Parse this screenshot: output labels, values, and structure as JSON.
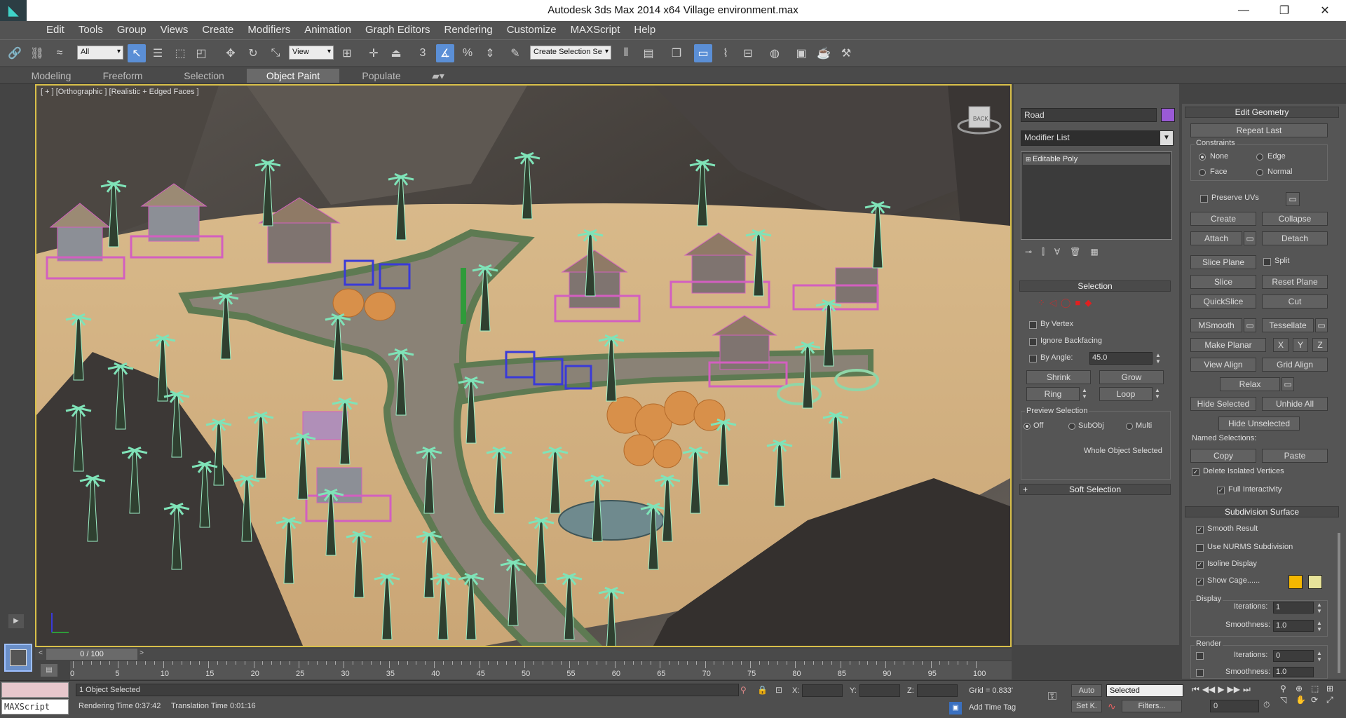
{
  "window": {
    "title": "Autodesk 3ds Max  2014 x64      Village environment.max",
    "min_glyph": "—",
    "max_glyph": "❐",
    "close_glyph": "✕"
  },
  "menu": [
    "Edit",
    "Tools",
    "Group",
    "Views",
    "Create",
    "Modifiers",
    "Animation",
    "Graph Editors",
    "Rendering",
    "Customize",
    "MAXScript",
    "Help"
  ],
  "toolbar": {
    "filter_value": "All",
    "refcoord_value": "View",
    "named_selection_placeholder": "Create Selection Se",
    "snap_3_label": "3",
    "snap_angle_label": "%"
  },
  "ribbon_tabs": [
    "Modeling",
    "Freeform",
    "Selection",
    "Object Paint",
    "Populate"
  ],
  "viewport": {
    "label": "[ + ] [Orthographic ] [Realistic + Edged Faces ]",
    "viewcube_label": "BACK"
  },
  "command_panel": {
    "object_name": "Road",
    "object_color": "#9a5ad6",
    "modifier_list": "Modifier List",
    "stack_item": "Editable Poly",
    "selection": {
      "header": "Selection",
      "by_vertex": "By Vertex",
      "ignore_backfacing": "Ignore Backfacing",
      "by_angle": "By Angle:",
      "angle_value": "45.0",
      "shrink": "Shrink",
      "grow": "Grow",
      "ring": "Ring",
      "loop": "Loop",
      "preview_selection": "Preview Selection",
      "off": "Off",
      "subobj": "SubObj",
      "multi": "Multi",
      "status": "Whole Object Selected"
    },
    "soft_selection": {
      "header": "Soft Selection",
      "plus": "+"
    },
    "edit_geometry": {
      "header": "Edit Geometry",
      "repeat_last": "Repeat Last",
      "constraints": "Constraints",
      "none": "None",
      "edge": "Edge",
      "face": "Face",
      "normal": "Normal",
      "preserve_uvs": "Preserve UVs",
      "create": "Create",
      "collapse": "Collapse",
      "attach": "Attach",
      "detach": "Detach",
      "slice_plane": "Slice Plane",
      "split": "Split",
      "slice": "Slice",
      "reset_plane": "Reset Plane",
      "quickslice": "QuickSlice",
      "cut": "Cut",
      "msmooth": "MSmooth",
      "tessellate": "Tessellate",
      "make_planar": "Make Planar",
      "x": "X",
      "y": "Y",
      "z": "Z",
      "view_align": "View Align",
      "grid_align": "Grid Align",
      "relax": "Relax",
      "hide_selected": "Hide Selected",
      "unhide_all": "Unhide All",
      "hide_unselected": "Hide Unselected",
      "named_selections": "Named Selections:",
      "copy": "Copy",
      "paste": "Paste",
      "delete_isolated": "Delete Isolated Vertices",
      "full_interactivity": "Full Interactivity"
    },
    "subdivision": {
      "header": "Subdivision Surface",
      "smooth_result": "Smooth Result",
      "use_nurms": "Use NURMS Subdivision",
      "isoline_display": "Isoline Display",
      "show_cage": "Show Cage......",
      "cage_color_1": "#f5b800",
      "cage_color_2": "#e8e49a",
      "display": "Display",
      "iterations_label": "Iterations:",
      "iterations_value": "1",
      "smoothness_label": "Smoothness:",
      "smoothness_value": "1.0",
      "render": "Render",
      "render_iterations_label": "Iterations:",
      "render_iterations_value": "0",
      "render_smoothness_label": "Smoothness:",
      "render_smoothness_value": "1.0"
    }
  },
  "timeline": {
    "frame": "0 / 100",
    "prev": "<",
    "next": ">",
    "ticks": [
      "0",
      "5",
      "10",
      "15",
      "20",
      "25",
      "30",
      "35",
      "40",
      "45",
      "50",
      "55",
      "60",
      "65",
      "70",
      "75",
      "80",
      "85",
      "90",
      "95",
      "100"
    ]
  },
  "status": {
    "maxscript": "MAXScript",
    "selected": "1 Object Selected",
    "rendering_time": "Rendering Time  0:37:42",
    "translation_time": "Translation Time  0:01:16",
    "x_label": "X:",
    "y_label": "Y:",
    "z_label": "Z:",
    "grid": "Grid = 0.833'",
    "add_time_tag": "Add Time Tag",
    "auto": "Auto",
    "set_k": "Set K.",
    "selected_dropdown": "Selected",
    "filters": "Filters...",
    "frame_field": "0"
  }
}
